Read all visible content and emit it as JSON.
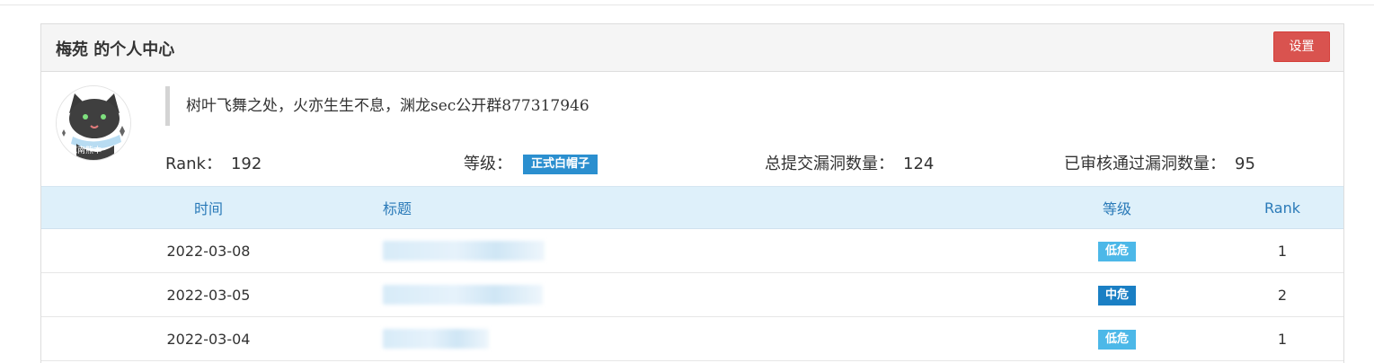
{
  "header": {
    "title": "梅苑 的个人中心",
    "settings_label": "设置"
  },
  "profile": {
    "avatar_icon": "cat-avatar-icon",
    "motto": "树叶飞舞之处，火亦生生不息，渊龙sec公开群877317946",
    "rank_label": "Rank：",
    "rank_value": "192",
    "level_label": "等级：",
    "level_badge": "正式白帽子",
    "submitted_label": "总提交漏洞数量：",
    "submitted_value": "124",
    "approved_label": "已审核通过漏洞数量：",
    "approved_value": "95"
  },
  "table": {
    "headers": {
      "time": "时间",
      "title": "标题",
      "level": "等级",
      "rank": "Rank"
    },
    "rows": [
      {
        "time": "2022-03-08",
        "level": "低危",
        "rank": "1"
      },
      {
        "time": "2022-03-05",
        "level": "中危",
        "rank": "2"
      },
      {
        "time": "2022-03-04",
        "level": "低危",
        "rank": "1"
      }
    ]
  },
  "colors": {
    "danger_button": "#d9534f",
    "badge_blue": "#2b8fcf",
    "low_severity": "#4cb8e8",
    "medium_severity": "#1a7fc4",
    "table_header_bg": "#def0fa",
    "table_header_text": "#2a7ab8"
  }
}
